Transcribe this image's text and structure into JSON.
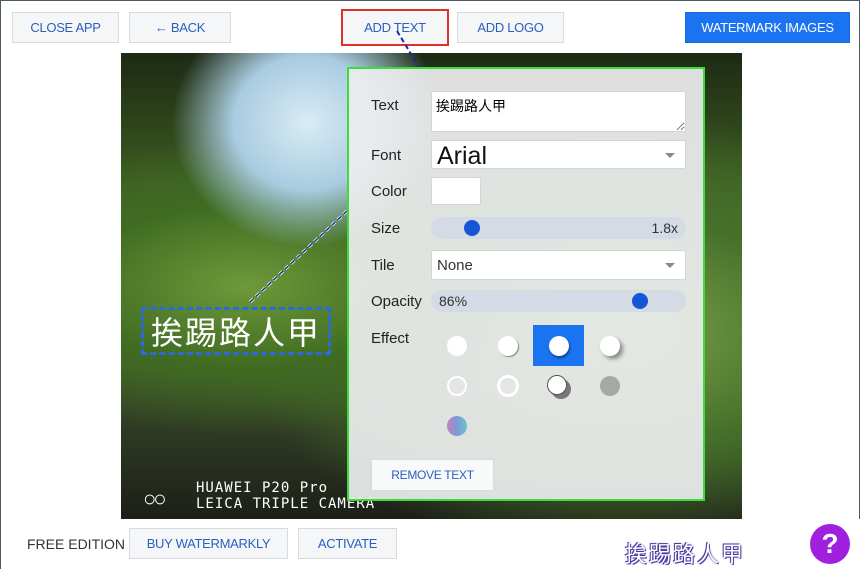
{
  "toolbar": {
    "close_app": "CLOSE APP",
    "back": "← BACK",
    "add_text": "ADD TEXT",
    "add_logo": "ADD LOGO",
    "watermark_images": "WATERMARK IMAGES"
  },
  "photo": {
    "watermark_text": "挨踢路人甲",
    "camera_line1": "HUAWEI P20 Pro",
    "camera_line2": "LEICA TRIPLE CAMERA",
    "rings": "○○"
  },
  "panel": {
    "text_label": "Text",
    "text_value": "挨踢路人甲",
    "font_label": "Font",
    "font_value": "Arial",
    "color_label": "Color",
    "color_value": "#ffffff",
    "size_label": "Size",
    "size_value": "1.8x",
    "size_fraction": 0.12,
    "tile_label": "Tile",
    "tile_value": "None",
    "opacity_label": "Opacity",
    "opacity_value": "86%",
    "opacity_fraction": 0.86,
    "effect_label": "Effect",
    "selected_effect": 2,
    "remove_text": "REMOVE TEXT"
  },
  "footer": {
    "edition": "FREE EDITION",
    "buy": "BUY WATERMARKLY",
    "activate": "ACTIVATE",
    "help": "?",
    "logo_text": "挨踢路人甲"
  },
  "colors": {
    "accent": "#1a73f0",
    "highlight": "#e0302a",
    "panel_border": "#3ddc3d",
    "help": "#a020e0"
  }
}
